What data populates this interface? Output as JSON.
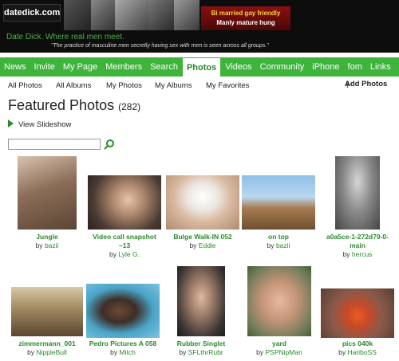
{
  "banner": {
    "logo": "datedick.com",
    "ad_line1": "Bi married gay friendly",
    "ad_line2": "Manly mature hung",
    "tagline": "Date Dick. Where real men meet.",
    "quote": "\"The practice of masculine men secretly having sex with men is seen across all groups.\""
  },
  "nav": {
    "items": [
      "News",
      "Invite",
      "My Page",
      "Members",
      "Search",
      "Photos",
      "Videos",
      "Community",
      "iPhone",
      "fom",
      "Links"
    ],
    "active": "Photos"
  },
  "subnav": {
    "items": [
      "All Photos",
      "All Albums",
      "My Photos",
      "My Albums",
      "My Favorites"
    ],
    "add": "Add Photos"
  },
  "title": "Featured Photos",
  "count": "(282)",
  "slideshow": "View Slideshow",
  "search": {
    "value": ""
  },
  "by_word": "by",
  "colors": {
    "brand_green": "#3eb43a",
    "link_green": "#2a8a2a"
  },
  "photos": [
    {
      "title": "Jungle",
      "author": "bazii"
    },
    {
      "title": "Video call snapshot ~13",
      "author": "Lyle G."
    },
    {
      "title": "Bulge Walk-IN 052",
      "author": "Eddie"
    },
    {
      "title": "on top",
      "author": "bazii"
    },
    {
      "title": "a0a5ce-1-272d79-0-main",
      "author": "hercus"
    },
    {
      "title": "zimmermann_001",
      "author": "NippleBull"
    },
    {
      "title": "Pedro Pictures A 058",
      "author": "Mitch"
    },
    {
      "title": "Rubber Singlet",
      "author": "SFLthrRubr"
    },
    {
      "title": "yard",
      "author": "PSPNipMan"
    },
    {
      "title": "pics 040k",
      "author": "HariboSS"
    }
  ]
}
